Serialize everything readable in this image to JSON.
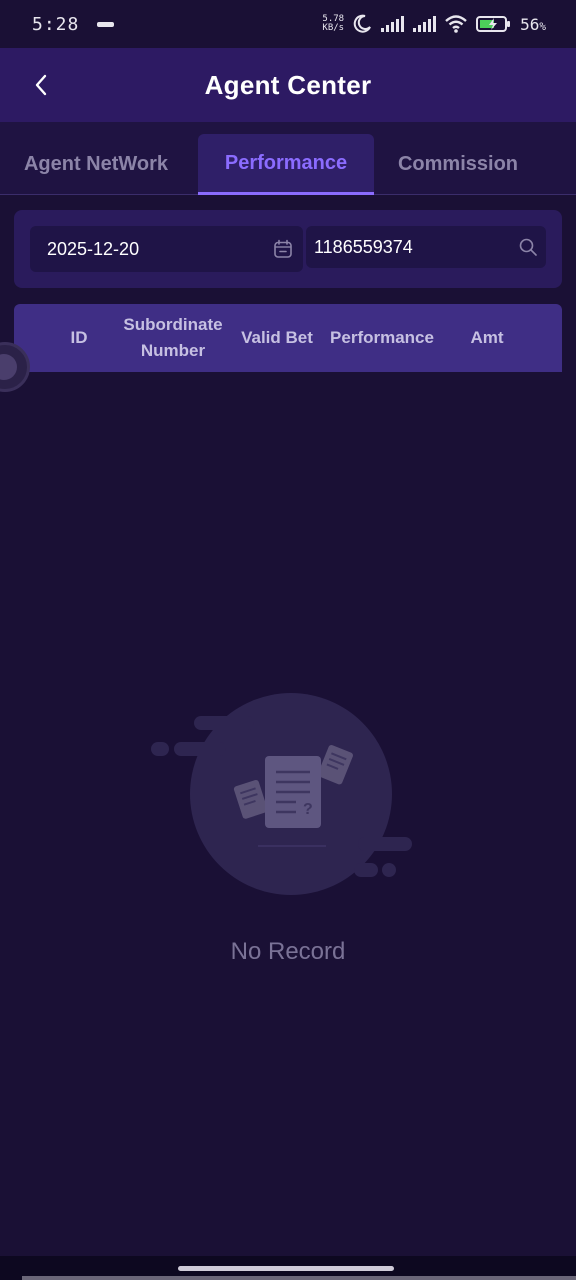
{
  "status_bar": {
    "time": "5:28",
    "net_speed_value": "5.78",
    "net_speed_unit": "KB/s",
    "battery": "56",
    "battery_suffix": "%"
  },
  "header": {
    "title": "Agent Center"
  },
  "tabs": [
    {
      "label": "Agent NetWork",
      "active": false
    },
    {
      "label": "Performance",
      "active": true
    },
    {
      "label": "Commission",
      "active": false
    }
  ],
  "filters": {
    "date_value": "2025-12-20",
    "search_value": "1186559374"
  },
  "table": {
    "columns": [
      "ID",
      "Subordinate Number",
      "Valid Bet",
      "Performance",
      "Amt"
    ]
  },
  "empty_state": {
    "text": "No Record"
  },
  "colors": {
    "background": "#1a1035",
    "header": "#2d1a63",
    "accent": "#8b6cff",
    "table_header": "#3f2e85"
  },
  "icons": [
    "back-arrow-icon",
    "calendar-icon",
    "search-icon",
    "no-record-illustration"
  ]
}
